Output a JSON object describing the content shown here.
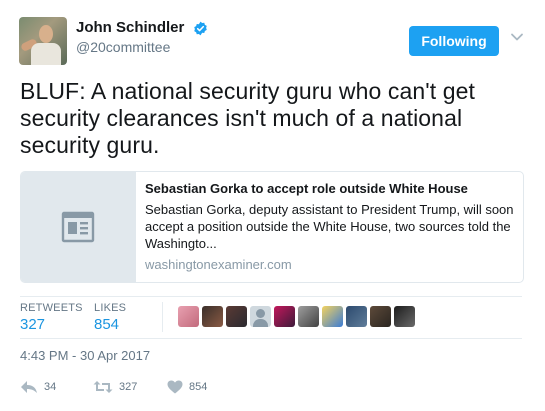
{
  "author": {
    "name": "John Schindler",
    "handle": "@20committee",
    "verified": true,
    "avatar_icon": "profile-photo"
  },
  "follow_button": {
    "label": "Following",
    "color": "#1da1f2"
  },
  "more_menu_icon": "chevron-down-icon",
  "tweet": {
    "text": "BLUF: A national security guru who can't get security clearances isn't much of a national security guru."
  },
  "card": {
    "thumbnail_icon": "article-icon",
    "title": "Sebastian Gorka to accept role outside White House",
    "description": "Sebastian Gorka, deputy assistant to President Trump, will soon accept a position outside the White House, two sources told the Washingto...",
    "domain": "washingtonexaminer.com"
  },
  "stats": {
    "retweets_label": "RETWEETS",
    "retweets_value": "327",
    "likes_label": "LIKES",
    "likes_value": "854"
  },
  "likers_count_shown": 10,
  "timestamp": "4:43 PM - 30 Apr 2017",
  "actions": {
    "reply_count": "34",
    "retweet_count": "327",
    "like_count": "854"
  },
  "colors": {
    "accent": "#1b95e0",
    "muted": "#657786",
    "border": "#e1e8ed"
  }
}
